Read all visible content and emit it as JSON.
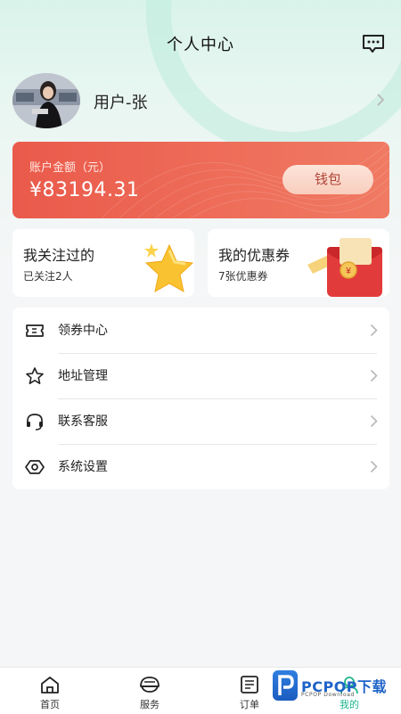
{
  "header": {
    "title": "个人中心",
    "message_icon": "chat-bubble-icon"
  },
  "profile": {
    "username": "用户-张",
    "avatar_icon": "user-photo"
  },
  "balance": {
    "label": "账户金额（元）",
    "amount": "¥83194.31",
    "wallet_button": "钱包"
  },
  "cards": {
    "following": {
      "title": "我关注过的",
      "subtitle": "已关注2人",
      "icon": "star-icon"
    },
    "coupons": {
      "title": "我的优惠券",
      "subtitle": "7张优惠券",
      "icon": "red-envelope-icon"
    }
  },
  "menu": [
    {
      "label": "领券中心",
      "icon": "ticket-icon"
    },
    {
      "label": "地址管理",
      "icon": "star-outline-icon"
    },
    {
      "label": "联系客服",
      "icon": "headset-icon"
    },
    {
      "label": "系统设置",
      "icon": "settings-icon"
    }
  ],
  "tabbar": {
    "active_index": 3,
    "items": [
      {
        "label": "首页",
        "icon": "home-icon"
      },
      {
        "label": "服务",
        "icon": "helmet-icon"
      },
      {
        "label": "订单",
        "icon": "order-icon"
      },
      {
        "label": "我的",
        "icon": "profile-icon"
      }
    ]
  },
  "watermark": {
    "text": "PCPOP下载",
    "sub": "PCPOP Download"
  },
  "colors": {
    "accent": "#1fb58a",
    "balance_card": "#ec6150",
    "wallet_button_text": "#b0453a"
  }
}
